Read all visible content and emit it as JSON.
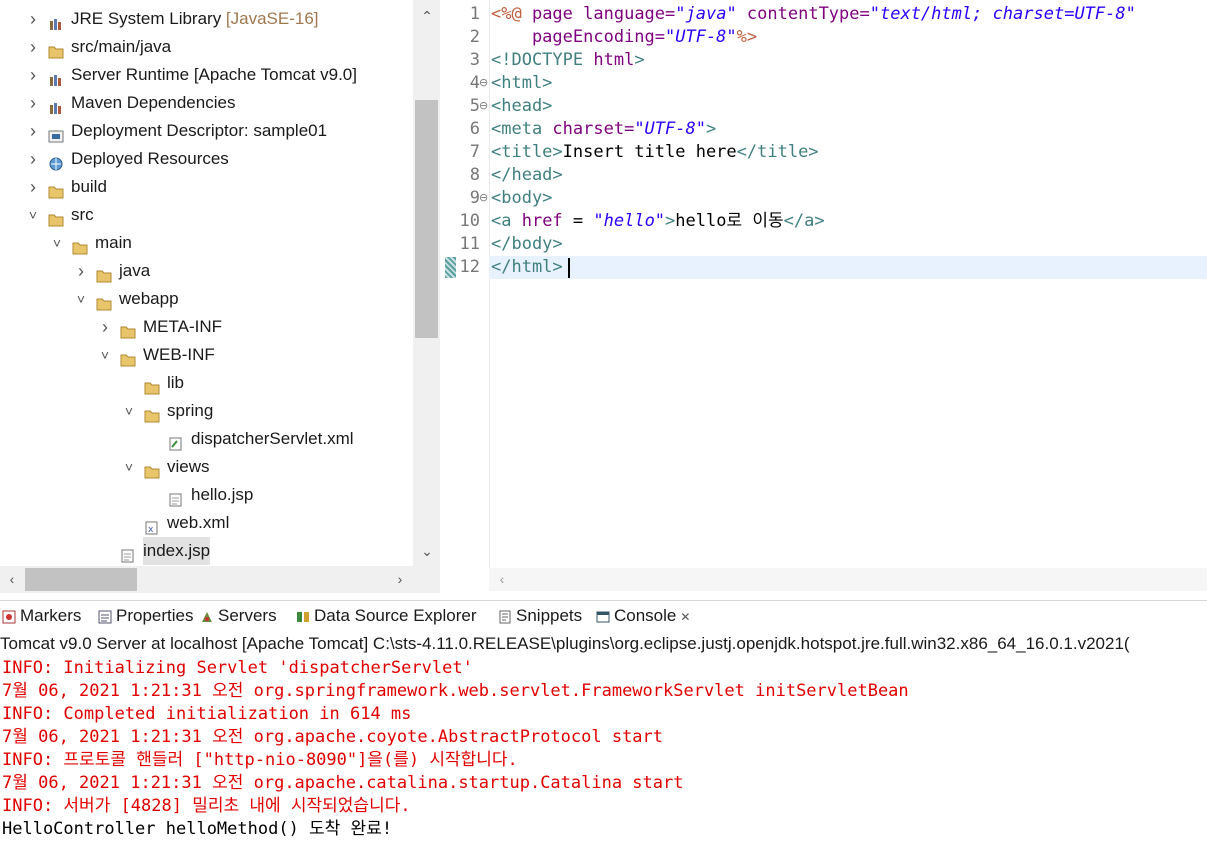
{
  "explorer": {
    "items": [
      {
        "label": "JRE System Library",
        "deco": " [JavaSE-16]",
        "icon": "library-icon",
        "expanded": false
      },
      {
        "label": "src/main/java",
        "deco": "",
        "icon": "source-folder-icon",
        "expanded": false
      },
      {
        "label": "Server Runtime [Apache Tomcat v9.0]",
        "deco": "",
        "icon": "library-icon",
        "expanded": false
      },
      {
        "label": "Maven Dependencies",
        "deco": "",
        "icon": "library-icon",
        "expanded": false
      },
      {
        "label": "Deployment Descriptor: sample01",
        "deco": "",
        "icon": "deployment-descriptor-icon",
        "expanded": false
      },
      {
        "label": "Deployed Resources",
        "deco": "",
        "icon": "deployed-resources-icon",
        "expanded": false
      },
      {
        "label": "build",
        "deco": "",
        "icon": "folder-icon",
        "expanded": false
      },
      {
        "label": "src",
        "deco": "",
        "icon": "folder-icon",
        "expanded": true
      },
      {
        "label": "main",
        "deco": "",
        "icon": "folder-icon",
        "expanded": true
      },
      {
        "label": "java",
        "deco": "",
        "icon": "folder-icon",
        "expanded": false
      },
      {
        "label": "webapp",
        "deco": "",
        "icon": "folder-icon",
        "expanded": true
      },
      {
        "label": "META-INF",
        "deco": "",
        "icon": "folder-icon",
        "expanded": false
      },
      {
        "label": "WEB-INF",
        "deco": "",
        "icon": "folder-icon",
        "expanded": true
      },
      {
        "label": "lib",
        "deco": "",
        "icon": "folder-icon",
        "expanded": null
      },
      {
        "label": "spring",
        "deco": "",
        "icon": "folder-icon",
        "expanded": true
      },
      {
        "label": "dispatcherServlet.xml",
        "deco": "",
        "icon": "spring-xml-icon",
        "expanded": null
      },
      {
        "label": "views",
        "deco": "",
        "icon": "folder-icon",
        "expanded": true
      },
      {
        "label": "hello.jsp",
        "deco": "",
        "icon": "jsp-file-icon",
        "expanded": null
      },
      {
        "label": "web.xml",
        "deco": "",
        "icon": "xml-file-icon",
        "expanded": null
      },
      {
        "label": "index.jsp",
        "deco": "",
        "icon": "jsp-file-icon",
        "expanded": null,
        "selected": true
      }
    ]
  },
  "editor": {
    "line_numbers": [
      "1",
      "2",
      "3",
      "4",
      "5",
      "6",
      "7",
      "8",
      "9",
      "10",
      "11",
      "12"
    ],
    "lines": [
      [
        {
          "t": "<%@ ",
          "c": "t-jsp"
        },
        {
          "t": "page ",
          "c": "t-attr"
        },
        {
          "t": "language=",
          "c": "t-attr"
        },
        {
          "t": "\"java\"",
          "c": "t-str"
        },
        {
          "t": " contentType=",
          "c": "t-attr"
        },
        {
          "t": "\"text/html; charset=UTF-8\"",
          "c": "t-str"
        }
      ],
      [
        {
          "t": "    pageEncoding=",
          "c": "t-attr"
        },
        {
          "t": "\"UTF-8\"",
          "c": "t-str"
        },
        {
          "t": "%>",
          "c": "t-jsp"
        }
      ],
      [
        {
          "t": "<!DOCTYPE ",
          "c": "t-tag"
        },
        {
          "t": "html",
          "c": "t-attr"
        },
        {
          "t": ">",
          "c": "t-tag"
        }
      ],
      [
        {
          "t": "<html>",
          "c": "t-tag"
        }
      ],
      [
        {
          "t": "<head>",
          "c": "t-tag"
        }
      ],
      [
        {
          "t": "<meta ",
          "c": "t-tag"
        },
        {
          "t": "charset=",
          "c": "t-attr"
        },
        {
          "t": "\"UTF-8\"",
          "c": "t-str"
        },
        {
          "t": ">",
          "c": "t-tag"
        }
      ],
      [
        {
          "t": "<title>",
          "c": "t-tag"
        },
        {
          "t": "Insert title here",
          "c": "t-txt"
        },
        {
          "t": "</title>",
          "c": "t-tag"
        }
      ],
      [
        {
          "t": "</head>",
          "c": "t-tag"
        }
      ],
      [
        {
          "t": "<body>",
          "c": "t-tag"
        }
      ],
      [
        {
          "t": "<a ",
          "c": "t-tag"
        },
        {
          "t": "href",
          "c": "t-attr"
        },
        {
          "t": " = ",
          "c": "t-txt"
        },
        {
          "t": "\"hello\"",
          "c": "t-str"
        },
        {
          "t": ">",
          "c": "t-tag"
        },
        {
          "t": "hello로 이동",
          "c": "t-txt"
        },
        {
          "t": "</a>",
          "c": "t-tag"
        }
      ],
      [
        {
          "t": "</body>",
          "c": "t-tag"
        }
      ],
      [
        {
          "t": "</html>",
          "c": "t-tag"
        }
      ]
    ],
    "fold_lines": [
      3,
      4,
      8
    ]
  },
  "tabs": [
    {
      "label": "Markers",
      "icon": "markers-icon"
    },
    {
      "label": "Properties",
      "icon": "properties-icon"
    },
    {
      "label": "Servers",
      "icon": "servers-icon"
    },
    {
      "label": "Data Source Explorer",
      "icon": "data-source-icon"
    },
    {
      "label": "Snippets",
      "icon": "snippets-icon"
    },
    {
      "label": "Console",
      "icon": "console-icon",
      "active": true
    }
  ],
  "console": {
    "title": "Tomcat v9.0 Server at localhost [Apache Tomcat] C:\\sts-4.11.0.RELEASE\\plugins\\org.eclipse.justj.openjdk.hotspot.jre.full.win32.x86_64_16.0.1.v2021(",
    "lines": [
      {
        "text": "INFO: Initializing Servlet 'dispatcherServlet'",
        "color": "red"
      },
      {
        "text": "7월 06, 2021 1:21:31 오전 org.springframework.web.servlet.FrameworkServlet initServletBean",
        "color": "red"
      },
      {
        "text": "INFO: Completed initialization in 614 ms",
        "color": "red"
      },
      {
        "text": "7월 06, 2021 1:21:31 오전 org.apache.coyote.AbstractProtocol start",
        "color": "red"
      },
      {
        "text": "INFO: 프로토콜 핸들러 [\"http-nio-8090\"]을(를) 시작합니다.",
        "color": "red"
      },
      {
        "text": "7월 06, 2021 1:21:31 오전 org.apache.catalina.startup.Catalina start",
        "color": "red"
      },
      {
        "text": "INFO: 서버가 [4828] 밀리초 내에 시작되었습니다.",
        "color": "red"
      },
      {
        "text": "HelloController helloMethod() 도착 완료!",
        "color": "black"
      }
    ]
  },
  "colors": {
    "console_error": "#e00000",
    "tag": "#3f7f7f",
    "attribute": "#7f007f",
    "string": "#2a00ff",
    "current_line": "#e8f2fe",
    "selection": "#e2e2e2"
  }
}
